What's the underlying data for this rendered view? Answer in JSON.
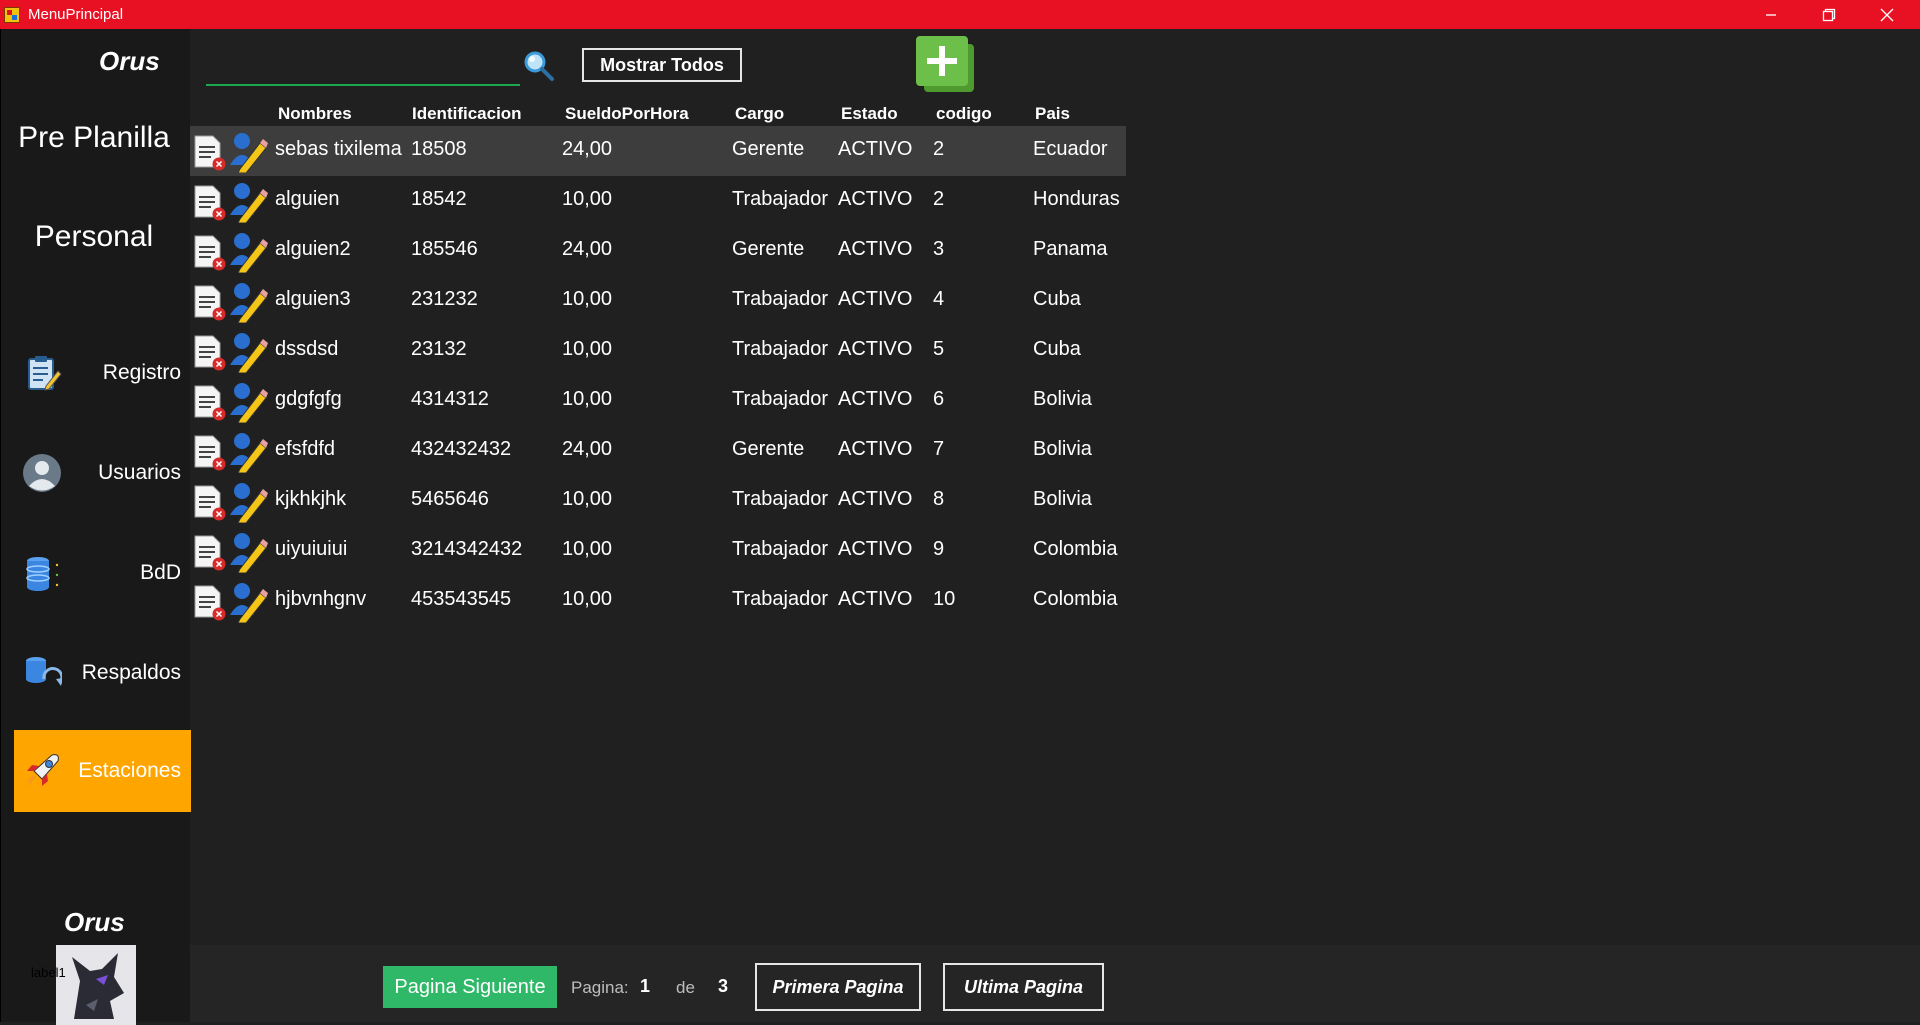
{
  "window": {
    "title": "MenuPrincipal"
  },
  "sidebar": {
    "brand_top": "Orus",
    "section_title_1": "Pre Planilla",
    "section_title_2": "Personal",
    "items": [
      {
        "label": "Registro",
        "icon": "clipboard-icon"
      },
      {
        "label": "Usuarios",
        "icon": "user-icon"
      },
      {
        "label": "BdD",
        "icon": "database-icon"
      },
      {
        "label": "Respaldos",
        "icon": "backup-icon"
      },
      {
        "label": "Estaciones",
        "icon": "rocket-icon",
        "active": true
      }
    ],
    "brand_bottom": "Orus",
    "avatar_label": "label1"
  },
  "toolbar": {
    "search_value": "",
    "show_all_label": "Mostrar Todos"
  },
  "table": {
    "columns": [
      "Nombres",
      "Identificacion",
      "SueldoPorHora",
      "Cargo",
      "Estado",
      "codigo",
      "Pais"
    ],
    "rows": [
      [
        "sebas tixilema",
        "18508",
        "24,00",
        "Gerente",
        "ACTIVO",
        "2",
        "Ecuador"
      ],
      [
        "alguien",
        "18542",
        "10,00",
        "Trabajador",
        "ACTIVO",
        "2",
        "Honduras"
      ],
      [
        "alguien2",
        "185546",
        "24,00",
        "Gerente",
        "ACTIVO",
        "3",
        "Panama"
      ],
      [
        "alguien3",
        "231232",
        "10,00",
        "Trabajador",
        "ACTIVO",
        "4",
        "Cuba"
      ],
      [
        "dssdsd",
        "23132",
        "10,00",
        "Trabajador",
        "ACTIVO",
        "5",
        "Cuba"
      ],
      [
        "gdgfgfg",
        "4314312",
        "10,00",
        "Trabajador",
        "ACTIVO",
        "6",
        "Bolivia"
      ],
      [
        "efsfdfd",
        "432432432",
        "24,00",
        "Gerente",
        "ACTIVO",
        "7",
        "Bolivia"
      ],
      [
        "kjkhkjhk",
        "5465646",
        "10,00",
        "Trabajador",
        "ACTIVO",
        "8",
        "Bolivia"
      ],
      [
        "uiyuiuiui",
        "3214342432",
        "10,00",
        "Trabajador",
        "ACTIVO",
        "9",
        "Colombia"
      ],
      [
        "hjbvnhgnv",
        "453543545",
        "10,00",
        "Trabajador",
        "ACTIVO",
        "10",
        "Colombia"
      ]
    ]
  },
  "pagination": {
    "next_label": "Pagina Siguiente",
    "page_label": "Pagina:",
    "current": "1",
    "of_label": "de",
    "total": "3",
    "first_label": "Primera Pagina",
    "last_label": "Ultima Pagina"
  },
  "colors": {
    "titlebar": "#e81123",
    "active_nav": "#ffa500",
    "next_button": "#2fb868",
    "add_button": "#6cc04a"
  }
}
